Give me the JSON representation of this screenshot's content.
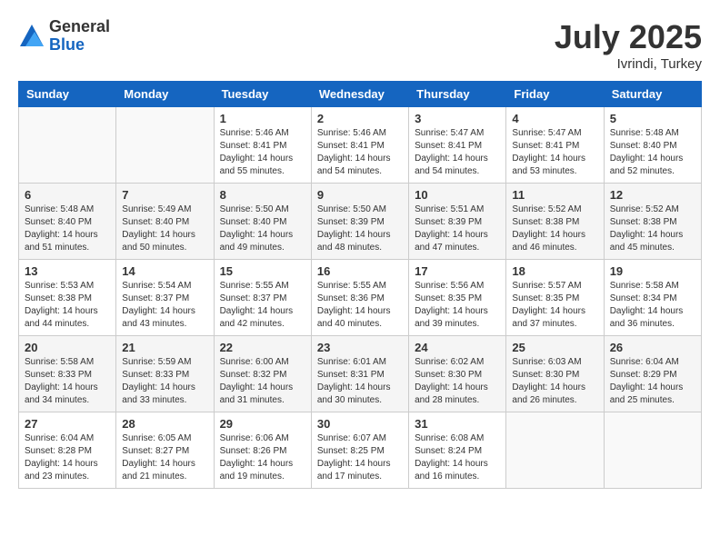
{
  "header": {
    "logo": {
      "general": "General",
      "blue": "Blue"
    },
    "title": "July 2025",
    "location": "Ivrindi, Turkey"
  },
  "calendar": {
    "days_of_week": [
      "Sunday",
      "Monday",
      "Tuesday",
      "Wednesday",
      "Thursday",
      "Friday",
      "Saturday"
    ],
    "weeks": [
      [
        {
          "day": "",
          "info": ""
        },
        {
          "day": "",
          "info": ""
        },
        {
          "day": "1",
          "info": "Sunrise: 5:46 AM\nSunset: 8:41 PM\nDaylight: 14 hours and 55 minutes."
        },
        {
          "day": "2",
          "info": "Sunrise: 5:46 AM\nSunset: 8:41 PM\nDaylight: 14 hours and 54 minutes."
        },
        {
          "day": "3",
          "info": "Sunrise: 5:47 AM\nSunset: 8:41 PM\nDaylight: 14 hours and 54 minutes."
        },
        {
          "day": "4",
          "info": "Sunrise: 5:47 AM\nSunset: 8:41 PM\nDaylight: 14 hours and 53 minutes."
        },
        {
          "day": "5",
          "info": "Sunrise: 5:48 AM\nSunset: 8:40 PM\nDaylight: 14 hours and 52 minutes."
        }
      ],
      [
        {
          "day": "6",
          "info": "Sunrise: 5:48 AM\nSunset: 8:40 PM\nDaylight: 14 hours and 51 minutes."
        },
        {
          "day": "7",
          "info": "Sunrise: 5:49 AM\nSunset: 8:40 PM\nDaylight: 14 hours and 50 minutes."
        },
        {
          "day": "8",
          "info": "Sunrise: 5:50 AM\nSunset: 8:40 PM\nDaylight: 14 hours and 49 minutes."
        },
        {
          "day": "9",
          "info": "Sunrise: 5:50 AM\nSunset: 8:39 PM\nDaylight: 14 hours and 48 minutes."
        },
        {
          "day": "10",
          "info": "Sunrise: 5:51 AM\nSunset: 8:39 PM\nDaylight: 14 hours and 47 minutes."
        },
        {
          "day": "11",
          "info": "Sunrise: 5:52 AM\nSunset: 8:38 PM\nDaylight: 14 hours and 46 minutes."
        },
        {
          "day": "12",
          "info": "Sunrise: 5:52 AM\nSunset: 8:38 PM\nDaylight: 14 hours and 45 minutes."
        }
      ],
      [
        {
          "day": "13",
          "info": "Sunrise: 5:53 AM\nSunset: 8:38 PM\nDaylight: 14 hours and 44 minutes."
        },
        {
          "day": "14",
          "info": "Sunrise: 5:54 AM\nSunset: 8:37 PM\nDaylight: 14 hours and 43 minutes."
        },
        {
          "day": "15",
          "info": "Sunrise: 5:55 AM\nSunset: 8:37 PM\nDaylight: 14 hours and 42 minutes."
        },
        {
          "day": "16",
          "info": "Sunrise: 5:55 AM\nSunset: 8:36 PM\nDaylight: 14 hours and 40 minutes."
        },
        {
          "day": "17",
          "info": "Sunrise: 5:56 AM\nSunset: 8:35 PM\nDaylight: 14 hours and 39 minutes."
        },
        {
          "day": "18",
          "info": "Sunrise: 5:57 AM\nSunset: 8:35 PM\nDaylight: 14 hours and 37 minutes."
        },
        {
          "day": "19",
          "info": "Sunrise: 5:58 AM\nSunset: 8:34 PM\nDaylight: 14 hours and 36 minutes."
        }
      ],
      [
        {
          "day": "20",
          "info": "Sunrise: 5:58 AM\nSunset: 8:33 PM\nDaylight: 14 hours and 34 minutes."
        },
        {
          "day": "21",
          "info": "Sunrise: 5:59 AM\nSunset: 8:33 PM\nDaylight: 14 hours and 33 minutes."
        },
        {
          "day": "22",
          "info": "Sunrise: 6:00 AM\nSunset: 8:32 PM\nDaylight: 14 hours and 31 minutes."
        },
        {
          "day": "23",
          "info": "Sunrise: 6:01 AM\nSunset: 8:31 PM\nDaylight: 14 hours and 30 minutes."
        },
        {
          "day": "24",
          "info": "Sunrise: 6:02 AM\nSunset: 8:30 PM\nDaylight: 14 hours and 28 minutes."
        },
        {
          "day": "25",
          "info": "Sunrise: 6:03 AM\nSunset: 8:30 PM\nDaylight: 14 hours and 26 minutes."
        },
        {
          "day": "26",
          "info": "Sunrise: 6:04 AM\nSunset: 8:29 PM\nDaylight: 14 hours and 25 minutes."
        }
      ],
      [
        {
          "day": "27",
          "info": "Sunrise: 6:04 AM\nSunset: 8:28 PM\nDaylight: 14 hours and 23 minutes."
        },
        {
          "day": "28",
          "info": "Sunrise: 6:05 AM\nSunset: 8:27 PM\nDaylight: 14 hours and 21 minutes."
        },
        {
          "day": "29",
          "info": "Sunrise: 6:06 AM\nSunset: 8:26 PM\nDaylight: 14 hours and 19 minutes."
        },
        {
          "day": "30",
          "info": "Sunrise: 6:07 AM\nSunset: 8:25 PM\nDaylight: 14 hours and 17 minutes."
        },
        {
          "day": "31",
          "info": "Sunrise: 6:08 AM\nSunset: 8:24 PM\nDaylight: 14 hours and 16 minutes."
        },
        {
          "day": "",
          "info": ""
        },
        {
          "day": "",
          "info": ""
        }
      ]
    ]
  }
}
